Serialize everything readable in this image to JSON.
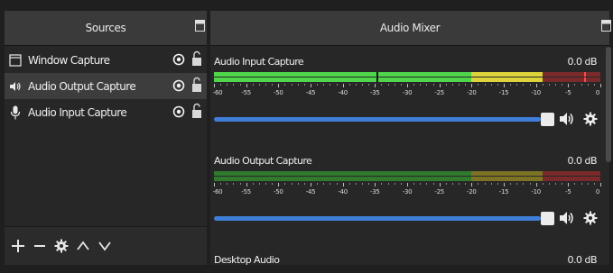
{
  "sources_dock": {
    "title": "Sources",
    "items": [
      {
        "label": "Window Capture",
        "icon": "window-icon",
        "selected": false
      },
      {
        "label": "Audio Output Capture",
        "icon": "speaker-icon",
        "selected": true
      },
      {
        "label": "Audio Input Capture",
        "icon": "microphone-icon",
        "selected": false
      }
    ],
    "toolbar": [
      "add-icon",
      "remove-icon",
      "gear-icon",
      "move-up-icon",
      "move-down-icon"
    ]
  },
  "mixer_dock": {
    "title": "Audio Mixer",
    "scale_labels": [
      "-60",
      "-55",
      "-50",
      "-45",
      "-40",
      "-35",
      "-30",
      "-25",
      "-20",
      "-15",
      "-10",
      "-5",
      "0"
    ],
    "channels": [
      {
        "name": "Audio Input Capture",
        "db": "0.0 dB",
        "level": 1.0,
        "volume": 1.0
      },
      {
        "name": "Audio Output Capture",
        "db": "0.0 dB",
        "level": 0.0,
        "volume": 1.0
      },
      {
        "name": "Desktop Audio",
        "db": "0.0 dB"
      }
    ]
  },
  "colors": {
    "green": "#4fd64a",
    "yellow": "#dcd43a",
    "red": "#d43a3a",
    "green_dim": "#2f7a2c",
    "yellow_dim": "#7c7424",
    "red_dim": "#7a2a2a",
    "slider": "#3f7fd9"
  }
}
